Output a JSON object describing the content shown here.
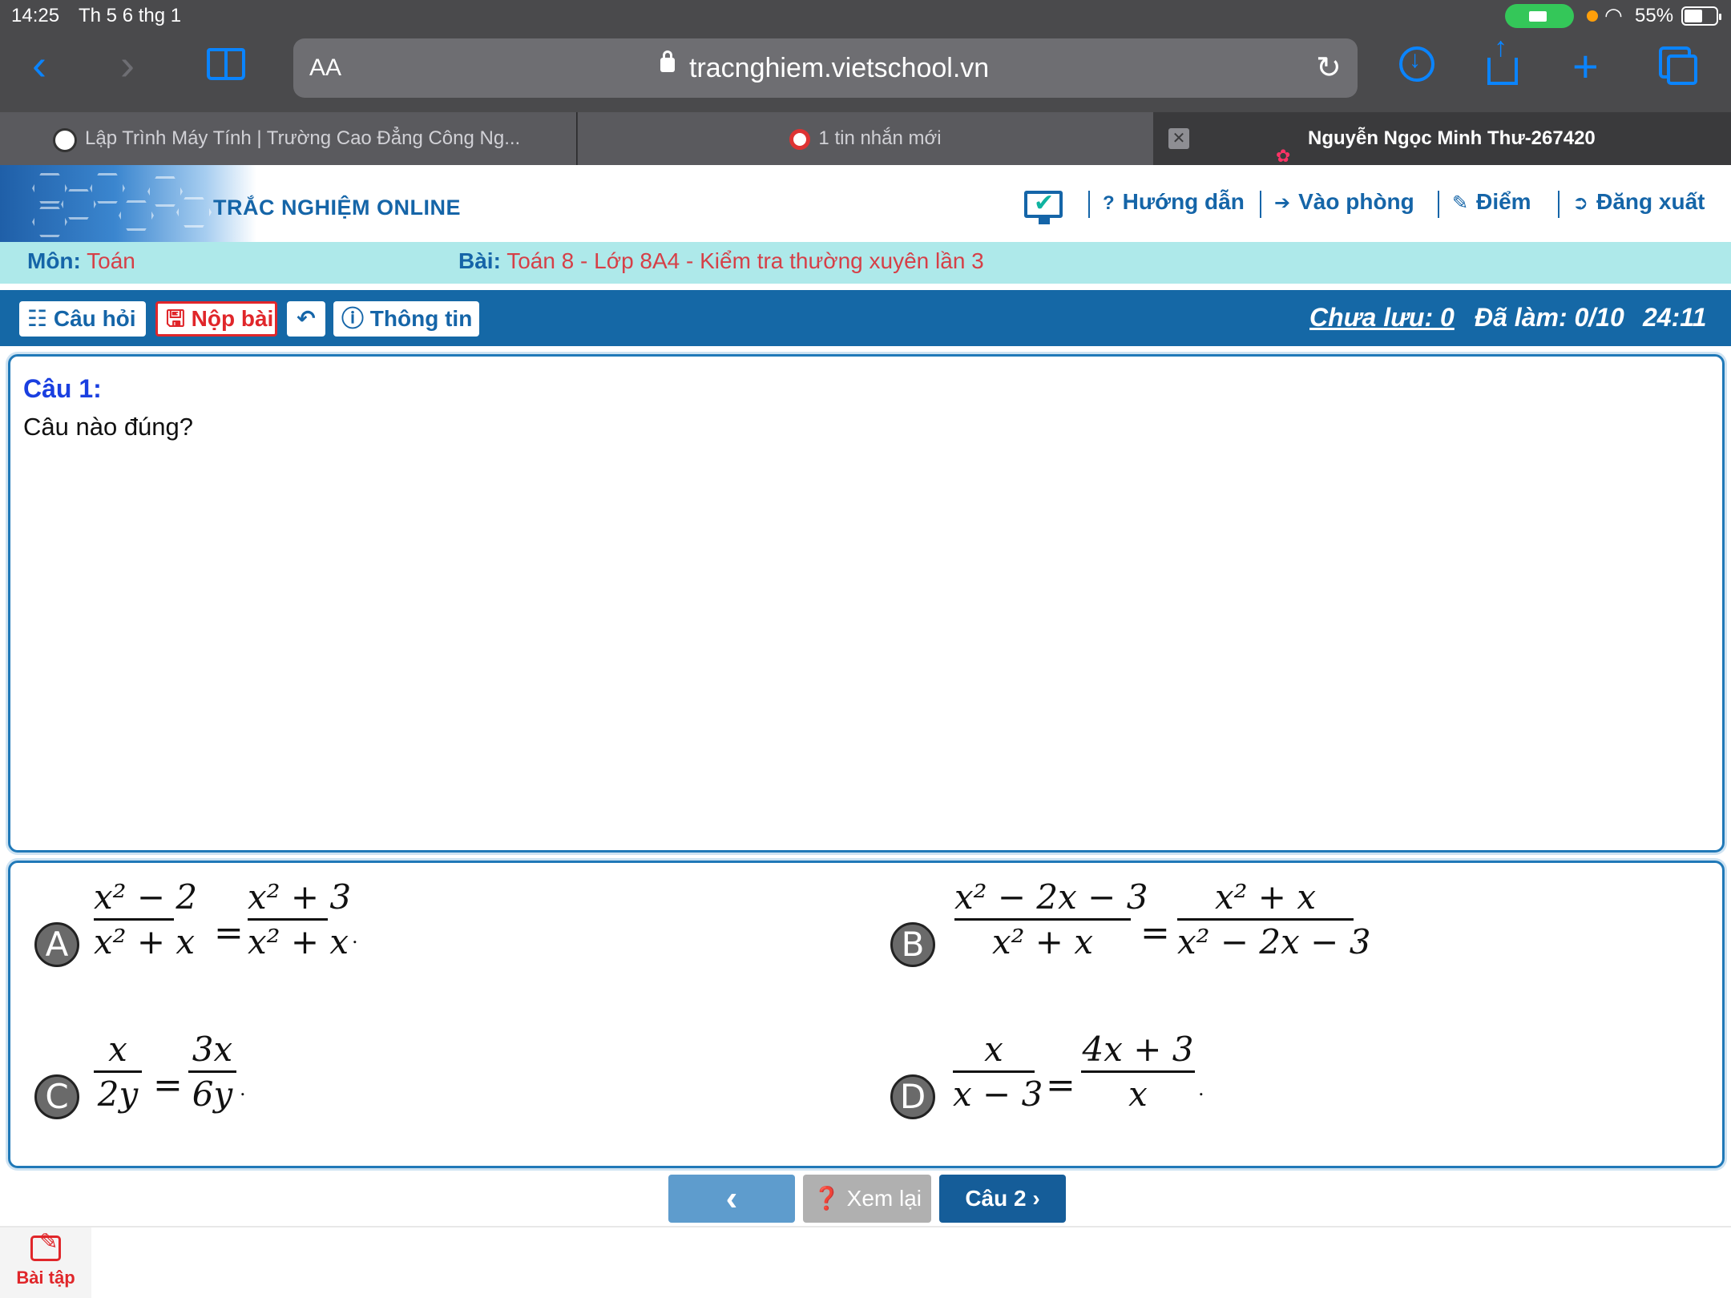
{
  "status_bar": {
    "time": "14:25",
    "date": "Th 5 6 thg 1",
    "battery": "55%"
  },
  "browser": {
    "aa_label": "AA",
    "url": "tracnghiem.vietschool.vn",
    "tabs": [
      {
        "label": "Lập Trình Máy Tính | Trường Cao Đẳng Công Ng..."
      },
      {
        "label": "1 tin nhắn mới"
      },
      {
        "label": "Nguyễn Ngọc Minh Thư-267420"
      }
    ],
    "accent_color": "#0a84ff"
  },
  "header": {
    "site_title": "TRẮC NGHIỆM ONLINE",
    "nav": [
      {
        "icon": "question-icon",
        "label": "Hướng dẫn"
      },
      {
        "icon": "sign-in-icon",
        "label": "Vào phòng"
      },
      {
        "icon": "edit-icon",
        "label": "Điểm"
      },
      {
        "icon": "sign-out-icon",
        "label": "Đăng xuất"
      }
    ]
  },
  "subject": {
    "mon_key": "Môn:",
    "mon_value": "Toán",
    "bai_key": "Bài:",
    "bai_value": "Toán 8 - Lớp 8A4 - Kiểm tra thường xuyên lần 3"
  },
  "actions": {
    "cau_hoi": "Câu hỏi",
    "nop_bai": "Nộp bài",
    "thong_tin": "Thông tin",
    "chua_luu": "Chưa lưu: 0",
    "da_lam": "Đã làm: 0/10",
    "timer": "24:11"
  },
  "question": {
    "number": "Câu 1:",
    "text": "Câu nào đúng?"
  },
  "options": {
    "A": {
      "letter": "A",
      "lhs_num": "x² − 2",
      "lhs_den": "x² + x",
      "rhs_num": "x² + 3",
      "rhs_den": "x² + x"
    },
    "B": {
      "letter": "B",
      "lhs_num": "x² − 2x − 3",
      "lhs_den": "x² + x",
      "rhs_num": "x² + x",
      "rhs_den": "x² − 2x − 3"
    },
    "C": {
      "letter": "C",
      "lhs_num": "x",
      "lhs_den": "2y",
      "rhs_num": "3x",
      "rhs_den": "6y"
    },
    "D": {
      "letter": "D",
      "lhs_num": "x",
      "lhs_den": "x − 3",
      "rhs_num": "4x + 3",
      "rhs_den": "x"
    },
    "equals": "=",
    "period": "."
  },
  "bottom_nav": {
    "prev": "‹",
    "review": "Xem lại",
    "next": "Câu 2"
  },
  "footer": {
    "tab_label": "Bài tập"
  },
  "colors": {
    "primary_blue": "#1565a8",
    "action_bar": "#1568a6",
    "subject_bar": "#aee9ea",
    "danger_red": "#e0262a",
    "question_number": "#1a3fe0"
  }
}
